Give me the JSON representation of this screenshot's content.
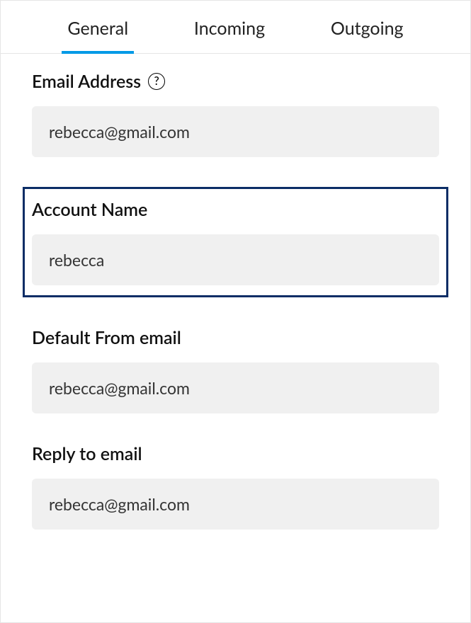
{
  "tabs": {
    "general": "General",
    "incoming": "Incoming",
    "outgoing": "Outgoing"
  },
  "fields": {
    "email_address": {
      "label": "Email Address",
      "value": "rebecca@gmail.com",
      "help_glyph": "?"
    },
    "account_name": {
      "label": "Account Name",
      "value": "rebecca"
    },
    "default_from": {
      "label": "Default From email",
      "value": "rebecca@gmail.com"
    },
    "reply_to": {
      "label": "Reply to email",
      "value": "rebecca@gmail.com"
    }
  }
}
